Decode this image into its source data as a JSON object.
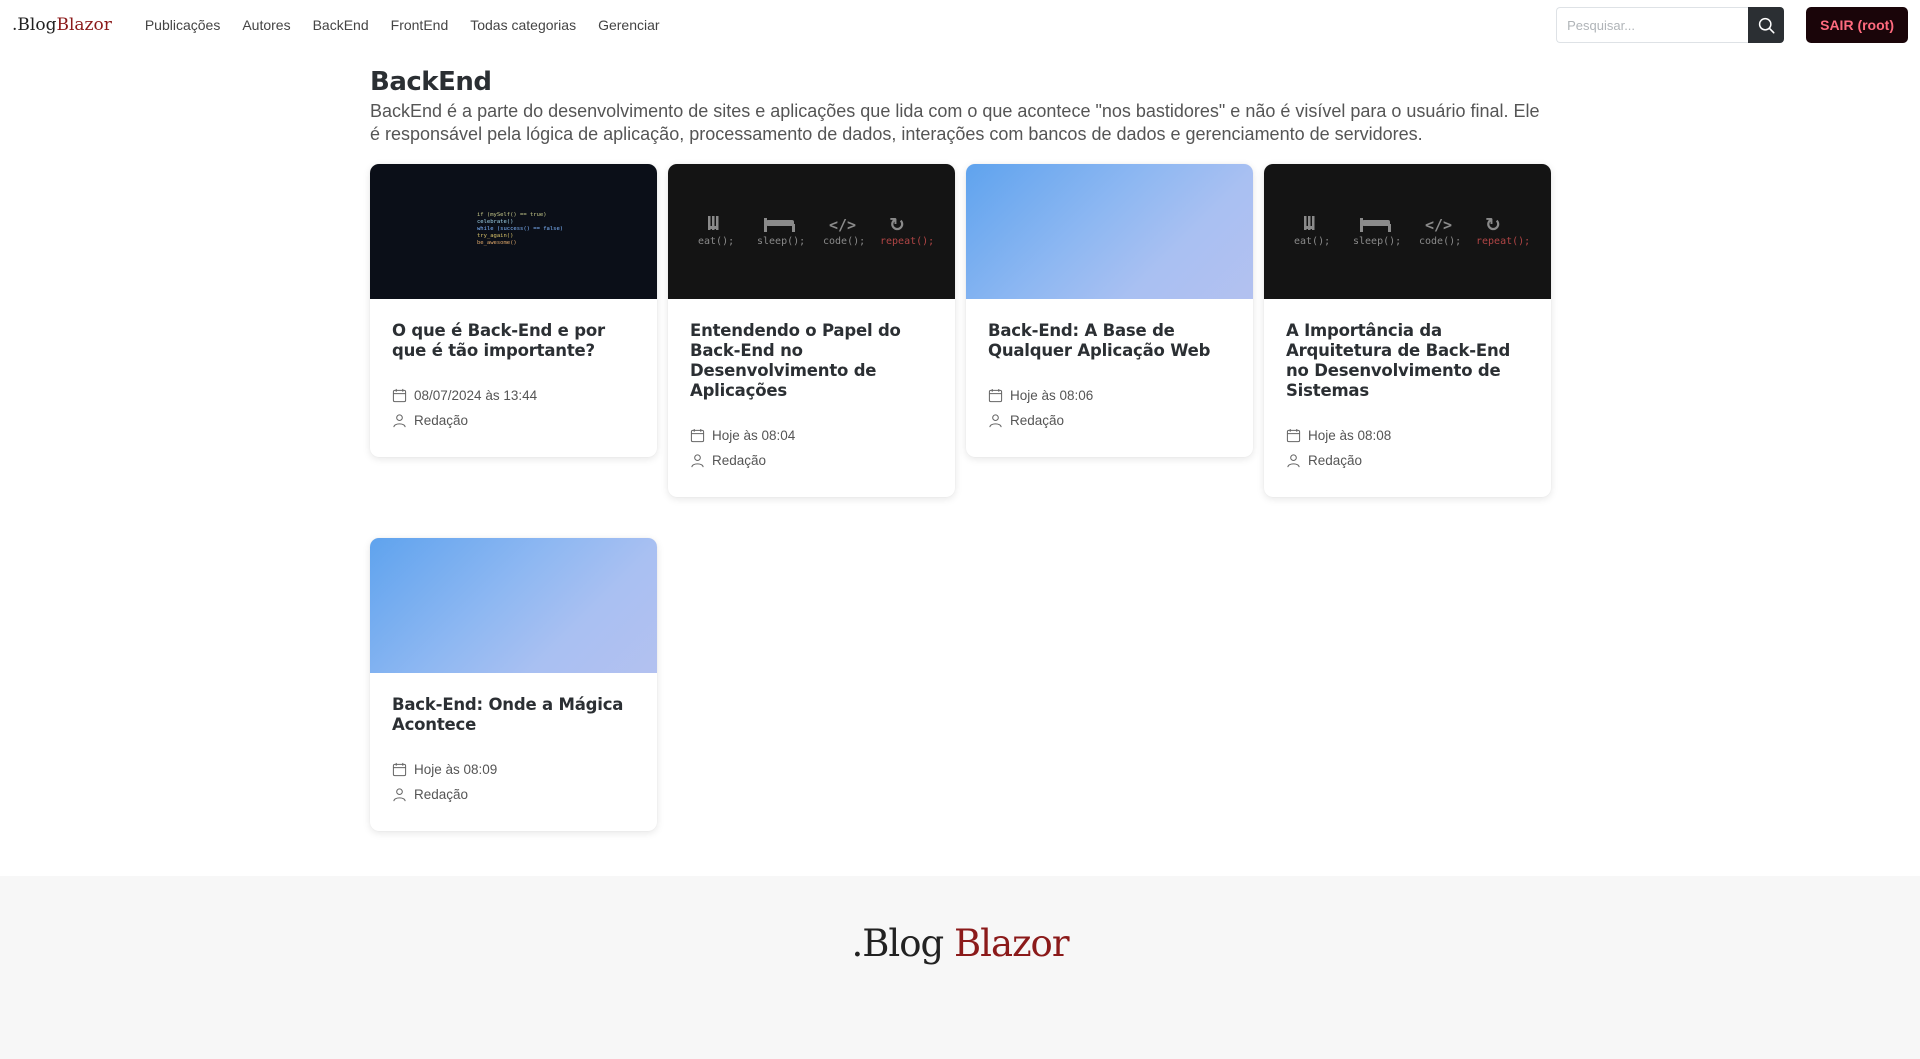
{
  "navbar": {
    "brand_prefix": ".Blog",
    "brand_accent": "Blazor",
    "links": [
      "Publicações",
      "Autores",
      "BackEnd",
      "FrontEnd",
      "Todas categorias",
      "Gerenciar"
    ],
    "search_placeholder": "Pesquisar...",
    "logout_label": "SAIR (root)"
  },
  "category": {
    "title": "BackEnd",
    "description": "BackEnd é a parte do desenvolvimento de sites e aplicações que lida com o que acontece \"nos bastidores\" e não é visível para o usuário final. Ele é responsável pela lógica de aplicação, processamento de dados, interações com bancos de dados e gerenciamento de servidores."
  },
  "posts": [
    {
      "title": "O que é Back-End e por que é tão importante?",
      "date": "08/07/2024 às 13:44",
      "author": "Redação",
      "image": "code-screen"
    },
    {
      "title": "Entendendo o Papel do Back-End no Desenvolvimento de Aplicações",
      "date": "Hoje às 08:04",
      "author": "Redação",
      "image": "eat-sleep-code-repeat"
    },
    {
      "title": "Back-End: A Base de Qualquer Aplicação Web",
      "date": "Hoje às 08:06",
      "author": "Redação",
      "image": "blue-gradient"
    },
    {
      "title": "A Importância da Arquitetura de Back-End no Desenvolvimento de Sistemas",
      "date": "Hoje às 08:08",
      "author": "Redação",
      "image": "eat-sleep-code-repeat"
    },
    {
      "title": "Back-End: Onde a Mágica Acontece",
      "date": "Hoje às 08:09",
      "author": "Redação",
      "image": "blue-gradient"
    }
  ],
  "eat_sleep_labels": [
    "eat();",
    "sleep();",
    "code();",
    "repeat();"
  ],
  "code_lines": [
    "if (mySelf() == true)",
    "  celebrate()",
    "while (success() == false)",
    "  try_again()",
    "  be_awesome()"
  ],
  "footer": {
    "brand_prefix": ".Blog",
    "brand_accent": "Blazor"
  },
  "colors": {
    "brand_accent": "#8b1a1a",
    "logout_bg": "#1a0509",
    "logout_text": "#ff6b7e",
    "search_btn": "#2b2f33",
    "footer_bg": "#f7f7f7"
  }
}
